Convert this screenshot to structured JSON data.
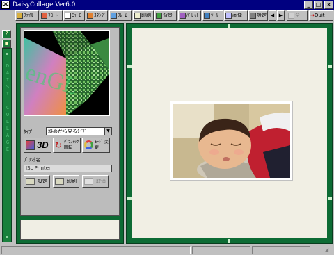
{
  "window": {
    "title": "DaisyCollage  Ver6.0",
    "app_icon_text": "DC",
    "buttons": {
      "minimize": "_",
      "maximize": "□",
      "close": "×"
    }
  },
  "toolbar": {
    "items": [
      {
        "label": "ﾌｧｲﾙ",
        "icon": "folder-icon"
      },
      {
        "label": "ﾌﾛｰﾄ",
        "icon": "float-icon"
      },
      {
        "label": "ﾆｭｰﾛ",
        "icon": "neuro-icon"
      },
      {
        "label": "ｽﾀﾝﾌﾟ",
        "icon": "stamp-icon"
      },
      {
        "label": "ﾌﾚｰﾑ",
        "icon": "frame-icon"
      },
      {
        "label": "印刷",
        "icon": "print-icon"
      },
      {
        "label": "背景",
        "icon": "background-icon"
      },
      {
        "label": "ﾊﾟﾚｯﾄ",
        "icon": "palette-icon"
      },
      {
        "label": "ﾂｰﾙ",
        "icon": "tool-icon"
      },
      {
        "label": "画像",
        "icon": "image-icon"
      },
      {
        "label": "設定",
        "icon": "settings-icon"
      }
    ],
    "nav_prev": "◀",
    "nav_next": "▶",
    "disabled_label": "全",
    "quit_label": "Quit"
  },
  "left_strip": {
    "help_label": "?",
    "vertical_text": "DAISY COLLAGE"
  },
  "panel": {
    "preview_text": "enGL",
    "type_label": "ﾀｲﾌﾟ",
    "type_value": "斜めから見るﾀｲﾌﾟ",
    "btn_3d": "3D",
    "btn_rotate": "ｸﾞﾗﾌｨｯｸ 回転",
    "btn_mode": "ﾓｰﾄﾞ 変更",
    "printer_label": "ﾌﾟﾘﾝﾀ名",
    "printer_value": "ISL Printer",
    "btn_settings": "設定",
    "btn_print": "印刷",
    "btn_cancel": "取消"
  },
  "status": {
    "pane1": "",
    "pane2": "",
    "pane3": ""
  },
  "colors": {
    "frame_green": "#0d6b34",
    "title_blue": "#000080"
  }
}
